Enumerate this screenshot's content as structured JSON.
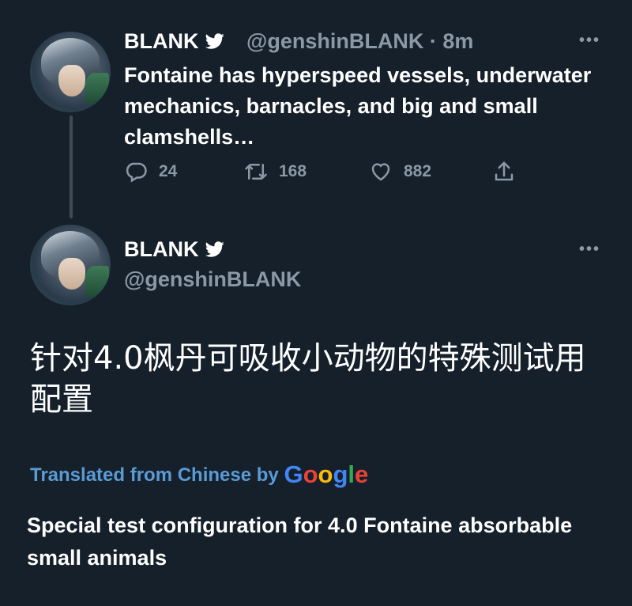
{
  "theme": {
    "background": "#15202b",
    "text": "#ffffff",
    "muted": "#8b98a5",
    "link": "#5b9bd5"
  },
  "reply_tweet": {
    "name": "BLANK",
    "handle_time": "@genshinBLANK · 8m",
    "text": "Fontaine has hyperspeed vessels, underwater mechanics, barnacles, and big and small clamshells…",
    "more": "•••",
    "actions": {
      "replies": "24",
      "retweets": "168",
      "likes": "882"
    }
  },
  "main_tweet": {
    "name": "BLANK",
    "handle": "@genshinBLANK",
    "more": "•••",
    "text_chinese": "针对4.0枫丹可吸收小动物的特殊测试用配置",
    "translated_label": "Translated from Chinese by",
    "google_letters": [
      {
        "ch": "G",
        "color": "#4285f4"
      },
      {
        "ch": "o",
        "color": "#ea4335"
      },
      {
        "ch": "o",
        "color": "#fbbc05"
      },
      {
        "ch": "g",
        "color": "#4285f4"
      },
      {
        "ch": "l",
        "color": "#34a853"
      },
      {
        "ch": "e",
        "color": "#ea4335"
      }
    ],
    "translation": "Special test configuration for 4.0 Fontaine absorbable small animals"
  }
}
